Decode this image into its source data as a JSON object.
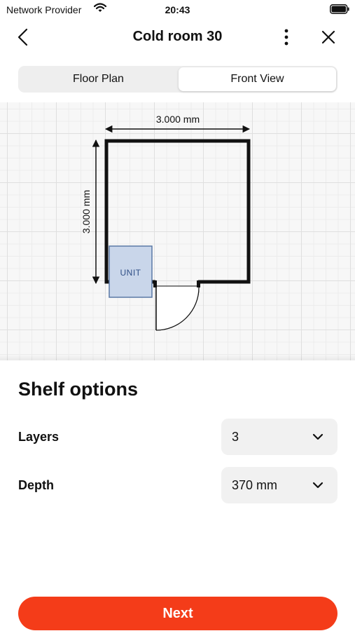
{
  "status_bar": {
    "provider": "Network Provider",
    "time": "20:43"
  },
  "header": {
    "title": "Cold room 30"
  },
  "tabs": [
    {
      "label": "Floor Plan",
      "selected": false
    },
    {
      "label": "Front View",
      "selected": true
    }
  ],
  "plan": {
    "width_label": "3.000 mm",
    "height_label": "3.000 mm",
    "unit_label": "UNIT"
  },
  "sheet": {
    "title": "Shelf options",
    "options": [
      {
        "label": "Layers",
        "value": "3"
      },
      {
        "label": "Depth",
        "value": "370 mm"
      }
    ]
  },
  "actions": {
    "next_label": "Next"
  },
  "colors": {
    "accent": "#f43c19",
    "unit_fill": "#c9d6ea",
    "unit_stroke": "#5a78a6"
  },
  "icons": {
    "back": "chevron-left-icon",
    "more": "more-vertical-icon",
    "close": "close-icon",
    "select": "chevron-down-icon"
  }
}
